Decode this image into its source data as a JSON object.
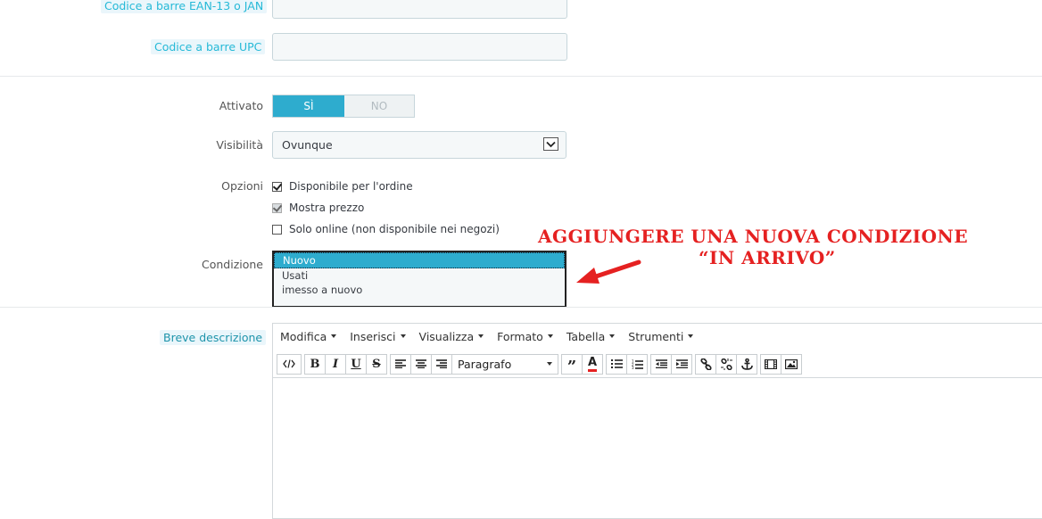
{
  "fields": {
    "ean_label": "Codice a barre EAN-13 o JAN",
    "upc_label": "Codice a barre UPC",
    "activated_label": "Attivato",
    "toggle_yes": "SÌ",
    "toggle_no": "NO",
    "visibility_label": "Visibilità",
    "visibility_value": "Ovunque",
    "options_label": "Opzioni",
    "options": [
      {
        "label": "Disponibile per l'ordine",
        "checked": true
      },
      {
        "label": "Mostra prezzo",
        "checked": true,
        "disabled": true
      },
      {
        "label": "Solo online (non disponibile nei negozi)",
        "checked": false
      }
    ],
    "condition_label": "Condizione",
    "condition_options": [
      "Nuovo",
      "Usati",
      "imesso a nuovo"
    ],
    "condition_selected": "Nuovo",
    "short_desc_label": "Breve descrizione"
  },
  "annotation": {
    "line1": "AGGIUNGERE UNA NUOVA CONDIZIONE",
    "line2": "“IN ARRIVO”",
    "color": "#e52121"
  },
  "editor": {
    "menu": [
      "Modifica",
      "Inserisci",
      "Visualizza",
      "Formato",
      "Tabella",
      "Strumenti"
    ],
    "format_value": "Paragrafo",
    "icons": [
      "source-code-icon",
      "bold-icon",
      "italic-icon",
      "underline-icon",
      "strikethrough-icon",
      "align-left-icon",
      "align-center-icon",
      "align-right-icon",
      "blockquote-icon",
      "text-color-icon",
      "bullet-list-icon",
      "numbered-list-icon",
      "outdent-icon",
      "indent-icon",
      "link-icon",
      "unlink-icon",
      "anchor-icon",
      "media-icon",
      "image-icon"
    ]
  },
  "colors": {
    "accent": "#2eacce",
    "label_highlight": "#25b9d7"
  }
}
